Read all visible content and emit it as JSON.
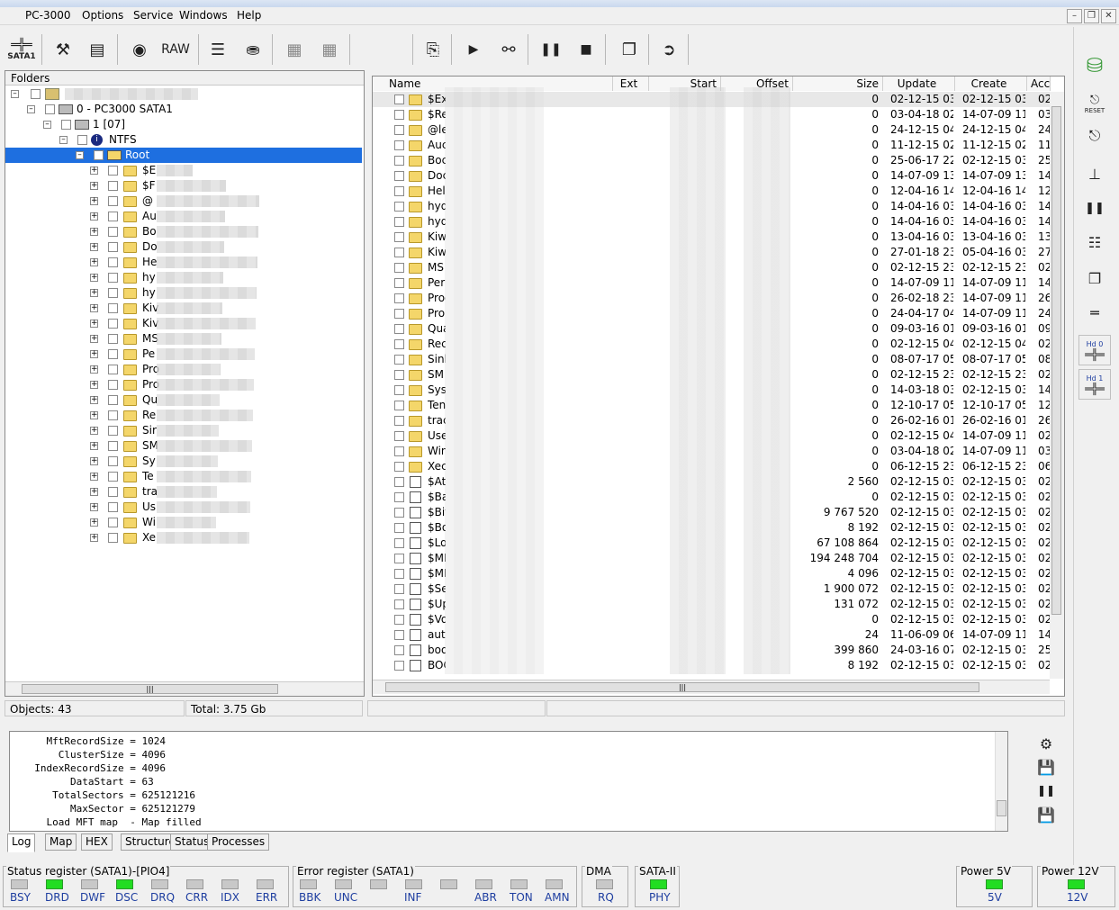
{
  "app": {
    "title": "PC-3000"
  },
  "menu": [
    "Options",
    "Service",
    "Windows",
    "Help"
  ],
  "toolbar": {
    "sata_label": "SATA1",
    "raw_label": "RAW"
  },
  "right_toolbar": {
    "reset_label": "RESET",
    "hd0_label": "Hd 0",
    "hd1_label": "Hd 1"
  },
  "folders": {
    "header": "Folders",
    "tree": [
      {
        "label": "0 - PC3000 SATA1"
      },
      {
        "label": "1 [07]"
      },
      {
        "label": "NTFS"
      },
      {
        "label": "Root"
      }
    ],
    "children": [
      "$E",
      "$F",
      "@",
      "Au",
      "Bo",
      "Do",
      "He",
      "hy",
      "hy",
      "Kiv",
      "Kiv",
      "MS",
      "Pe",
      "Pro",
      "Pro",
      "Qu",
      "Re",
      "Sir",
      "SM",
      "Sy",
      "Te",
      "tra",
      "Us",
      "Wi",
      "Xe"
    ]
  },
  "files": {
    "columns": [
      "Name",
      "Ext",
      "Start",
      "Offset",
      "Size",
      "Update",
      "Create",
      "Acc"
    ],
    "rows": [
      {
        "n": "$Ex",
        "s": "0",
        "u": "02-12-15 03...",
        "c": "02-12-15 03...",
        "a": "02",
        "f": true
      },
      {
        "n": "$Re",
        "s": "0",
        "u": "03-04-18 02...",
        "c": "14-07-09 11...",
        "a": "03",
        "f": true
      },
      {
        "n": "@le",
        "s": "0",
        "u": "24-12-15 04...",
        "c": "24-12-15 04...",
        "a": "24",
        "f": true
      },
      {
        "n": "Auc",
        "s": "0",
        "u": "11-12-15 02...",
        "c": "11-12-15 02...",
        "a": "11",
        "f": true
      },
      {
        "n": "Boc",
        "s": "0",
        "u": "25-06-17 22...",
        "c": "02-12-15 03...",
        "a": "25",
        "f": true
      },
      {
        "n": "Doc",
        "s": "0",
        "u": "14-07-09 13...",
        "c": "14-07-09 13...",
        "a": "14",
        "f": true
      },
      {
        "n": "Help",
        "s": "0",
        "u": "12-04-16 14...",
        "c": "12-04-16 14...",
        "a": "12",
        "f": true
      },
      {
        "n": "hyd",
        "s": "0",
        "u": "14-04-16 03...",
        "c": "14-04-16 03...",
        "a": "14",
        "f": true
      },
      {
        "n": "hyd",
        "s": "0",
        "u": "14-04-16 03...",
        "c": "14-04-16 03...",
        "a": "14",
        "f": true
      },
      {
        "n": "Kiw",
        "s": "0",
        "u": "13-04-16 03...",
        "c": "13-04-16 03...",
        "a": "13",
        "f": true
      },
      {
        "n": "Kiw",
        "s": "0",
        "u": "27-01-18 23...",
        "c": "05-04-16 03...",
        "a": "27",
        "f": true
      },
      {
        "n": "MS",
        "s": "0",
        "u": "02-12-15 23...",
        "c": "02-12-15 23...",
        "a": "02",
        "f": true
      },
      {
        "n": "Perl",
        "s": "0",
        "u": "14-07-09 11...",
        "c": "14-07-09 11...",
        "a": "14",
        "f": true
      },
      {
        "n": "Prog",
        "s": "0",
        "u": "26-02-18 23...",
        "c": "14-07-09 11...",
        "a": "26",
        "f": true
      },
      {
        "n": "Pro",
        "s": "0",
        "u": "24-04-17 04...",
        "c": "14-07-09 11...",
        "a": "24",
        "f": true
      },
      {
        "n": "Qua",
        "s": "0",
        "u": "09-03-16 01...",
        "c": "09-03-16 01...",
        "a": "09",
        "f": true
      },
      {
        "n": "Rec",
        "s": "0",
        "u": "02-12-15 04...",
        "c": "02-12-15 04...",
        "a": "02",
        "f": true
      },
      {
        "n": "Sinl",
        "s": "0",
        "u": "08-07-17 05...",
        "c": "08-07-17 05...",
        "a": "08",
        "f": true
      },
      {
        "n": "SM",
        "s": "0",
        "u": "02-12-15 23...",
        "c": "02-12-15 23...",
        "a": "02",
        "f": true
      },
      {
        "n": "Sys",
        "s": "0",
        "u": "14-03-18 03...",
        "c": "02-12-15 03...",
        "a": "14",
        "f": true
      },
      {
        "n": "Ten",
        "s": "0",
        "u": "12-10-17 05...",
        "c": "12-10-17 05...",
        "a": "12",
        "f": true
      },
      {
        "n": "trac",
        "s": "0",
        "u": "26-02-16 01...",
        "c": "26-02-16 01...",
        "a": "26",
        "f": true
      },
      {
        "n": "Use",
        "s": "0",
        "u": "02-12-15 04...",
        "c": "14-07-09 11...",
        "a": "02",
        "f": true
      },
      {
        "n": "Win",
        "s": "0",
        "u": "03-04-18 02...",
        "c": "14-07-09 11...",
        "a": "03",
        "f": true
      },
      {
        "n": "Xec",
        "s": "0",
        "u": "06-12-15 23...",
        "c": "06-12-15 23...",
        "a": "06",
        "f": true
      },
      {
        "n": "$Att",
        "s": "2 560",
        "u": "02-12-15 03...",
        "c": "02-12-15 03...",
        "a": "02",
        "f": false
      },
      {
        "n": "$Ba",
        "s": "0",
        "u": "02-12-15 03...",
        "c": "02-12-15 03...",
        "a": "02",
        "f": false
      },
      {
        "n": "$Bit",
        "s": "9 767 520",
        "u": "02-12-15 03...",
        "c": "02-12-15 03...",
        "a": "02",
        "f": false
      },
      {
        "n": "$Bo",
        "s": "8 192",
        "u": "02-12-15 03...",
        "c": "02-12-15 03...",
        "a": "02",
        "f": false
      },
      {
        "n": "$Lo",
        "s": "67 108 864",
        "u": "02-12-15 03...",
        "c": "02-12-15 03...",
        "a": "02",
        "f": false
      },
      {
        "n": "$MI",
        "s": "194 248 704",
        "u": "02-12-15 03...",
        "c": "02-12-15 03...",
        "a": "02",
        "f": false
      },
      {
        "n": "$MI",
        "s": "4 096",
        "u": "02-12-15 03...",
        "c": "02-12-15 03...",
        "a": "02",
        "f": false
      },
      {
        "n": "$Se",
        "s": "1 900 072",
        "u": "02-12-15 03...",
        "c": "02-12-15 03...",
        "a": "02",
        "f": false
      },
      {
        "n": "$Up",
        "s": "131 072",
        "u": "02-12-15 03...",
        "c": "02-12-15 03...",
        "a": "02",
        "f": false
      },
      {
        "n": "$Vo",
        "s": "0",
        "u": "02-12-15 03...",
        "c": "02-12-15 03...",
        "a": "02",
        "f": false
      },
      {
        "n": "auto",
        "s": "24",
        "u": "11-06-09 06...",
        "c": "14-07-09 11...",
        "a": "14",
        "f": false
      },
      {
        "n": "boo",
        "s": "399 860",
        "u": "24-03-16 07...",
        "c": "02-12-15 03...",
        "a": "25",
        "f": false
      },
      {
        "n": "BOC",
        "s": "8 192",
        "u": "02-12-15 03...",
        "c": "02-12-15 03...",
        "a": "02",
        "f": false
      }
    ]
  },
  "status": {
    "objects": "Objects: 43",
    "total": "Total: 3.75 Gb"
  },
  "log": {
    "lines": [
      "    MftRecordSize = 1024",
      "      ClusterSize = 4096",
      "  IndexRecordSize = 4096",
      "        DataStart = 63",
      "     TotalSectors = 625121216",
      "        MaxSector = 625121279",
      "    Load MFT map  - Map filled"
    ],
    "tabs": [
      "Log",
      "Map",
      "HEX",
      "Structure",
      "Status",
      "Processes"
    ]
  },
  "registers": {
    "status_title": "Status register (SATA1)-[PIO4]",
    "status_leds": [
      {
        "label": "BSY",
        "on": false
      },
      {
        "label": "DRD",
        "on": true
      },
      {
        "label": "DWF",
        "on": false
      },
      {
        "label": "DSC",
        "on": true
      },
      {
        "label": "DRQ",
        "on": false
      },
      {
        "label": "CRR",
        "on": false
      },
      {
        "label": "IDX",
        "on": false
      },
      {
        "label": "ERR",
        "on": false
      }
    ],
    "error_title": "Error register (SATA1)",
    "error_leds": [
      {
        "label": "BBK",
        "on": false
      },
      {
        "label": "UNC",
        "on": false
      },
      {
        "label": "",
        "on": false
      },
      {
        "label": "INF",
        "on": false
      },
      {
        "label": "",
        "on": false
      },
      {
        "label": "ABR",
        "on": false
      },
      {
        "label": "TON",
        "on": false
      },
      {
        "label": "AMN",
        "on": false
      }
    ],
    "dma_title": "DMA",
    "dma_label": "RQ",
    "sata_title": "SATA-II",
    "sata_label": "PHY",
    "power5_title": "Power 5V",
    "power5_label": "5V",
    "power12_title": "Power 12V",
    "power12_label": "12V"
  }
}
